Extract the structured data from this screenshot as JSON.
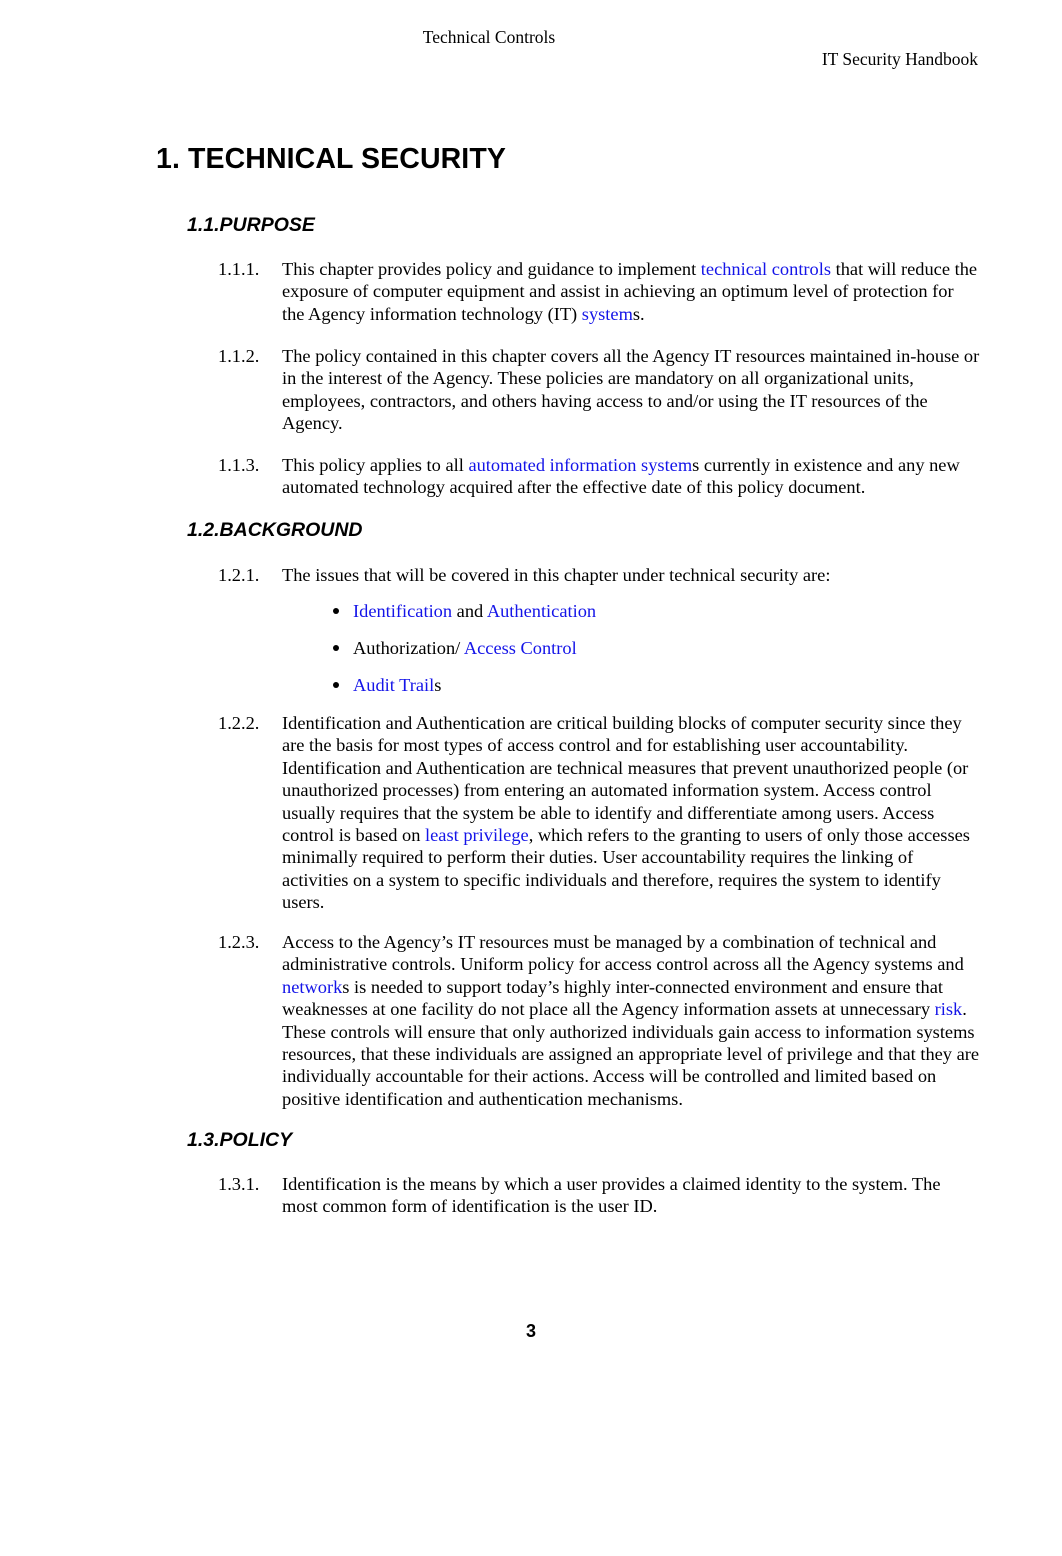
{
  "document": {
    "header": {
      "running_title": "Technical Controls",
      "handbook_title": "IT Security Handbook"
    },
    "footer": {
      "page_number": "3"
    },
    "chapter_title": "1. TECHNICAL SECURITY",
    "link_color": "#1414e8",
    "text_color": "#000000",
    "background_color": "#ffffff",
    "sections": {
      "purpose": {
        "heading": "1.1.PURPOSE",
        "clauses": [
          {
            "number": "1.1.1.",
            "segments": [
              {
                "text": "This chapter provides policy and guidance to implement ",
                "link": false
              },
              {
                "text": "technical controls",
                "link": true
              },
              {
                "text": " that will reduce the exposure of computer equipment and assist in achieving an optimum level of protection for the Agency information technology (IT) ",
                "link": false
              },
              {
                "text": "system",
                "link": true
              },
              {
                "text": "s.",
                "link": false
              }
            ]
          },
          {
            "number": "1.1.2.",
            "segments": [
              {
                "text": "The policy contained in this chapter covers all the Agency IT resources maintained in-house or in the interest of the Agency.  These policies are mandatory on all organizational units, employees, contractors, and others having access to and/or using the IT resources of the Agency.",
                "link": false
              }
            ]
          },
          {
            "number": "1.1.3.",
            "segments": [
              {
                "text": "This policy applies to all ",
                "link": false
              },
              {
                "text": "automated information system",
                "link": true
              },
              {
                "text": "s currently in existence and any new automated technology acquired after the effective date of this policy document.",
                "link": false
              }
            ]
          }
        ]
      },
      "background": {
        "heading": "1.2.BACKGROUND",
        "clauses": [
          {
            "number": "1.2.1.",
            "segments": [
              {
                "text": "The issues that will be covered in this chapter under technical security are:",
                "link": false
              }
            ]
          },
          {
            "number": "1.2.2.",
            "segments": [
              {
                "text": "Identification and Authentication are critical building blocks of computer security since they are the basis for most types of access control and for establishing user accountability.  Identification and Authentication are technical measures that prevent unauthorized people (or unauthorized processes) from entering an automated information system.  Access control usually requires that the system be able to identify and differentiate among users.  Access control is based on ",
                "link": false
              },
              {
                "text": "least privilege",
                "link": true
              },
              {
                "text": ", which refers to the granting to users of only those accesses minimally required to perform their duties.  User accountability requires the linking of activities on a system to specific individuals and therefore, requires the system to identify users.",
                "link": false
              }
            ]
          },
          {
            "number": "1.2.3.",
            "segments": [
              {
                "text": "Access to the Agency’s IT resources must be managed by a combination of technical and administrative controls.  Uniform policy for access control across all the Agency systems and ",
                "link": false
              },
              {
                "text": "network",
                "link": true
              },
              {
                "text": "s is needed to support today’s highly inter-connected environment and ensure that weaknesses at one facility do not place all the Agency information assets at unnecessary ",
                "link": false
              },
              {
                "text": "risk",
                "link": true
              },
              {
                "text": ".  These controls will ensure that only authorized individuals gain access to information systems resources, that these individuals are assigned an appropriate level of privilege and that they are individually accountable for their actions.  Access will be controlled and limited based on positive identification and authentication mechanisms.",
                "link": false
              }
            ]
          }
        ],
        "bullets": [
          {
            "segments": [
              {
                "text": "Identification",
                "link": true
              },
              {
                "text": " and ",
                "link": false
              },
              {
                "text": "Authentication",
                "link": true
              }
            ]
          },
          {
            "segments": [
              {
                "text": "Authorization/ ",
                "link": false
              },
              {
                "text": "Access Control",
                "link": true
              }
            ]
          },
          {
            "segments": [
              {
                "text": "Audit Trail",
                "link": true
              },
              {
                "text": "s",
                "link": false
              }
            ]
          }
        ]
      },
      "policy": {
        "heading": "1.3.POLICY",
        "clauses": [
          {
            "number": "1.3.1.",
            "segments": [
              {
                "text": "Identification is the means by which a user provides a claimed identity to the system.  The most common form of identification is the user ID.",
                "link": false
              }
            ]
          }
        ]
      }
    }
  }
}
